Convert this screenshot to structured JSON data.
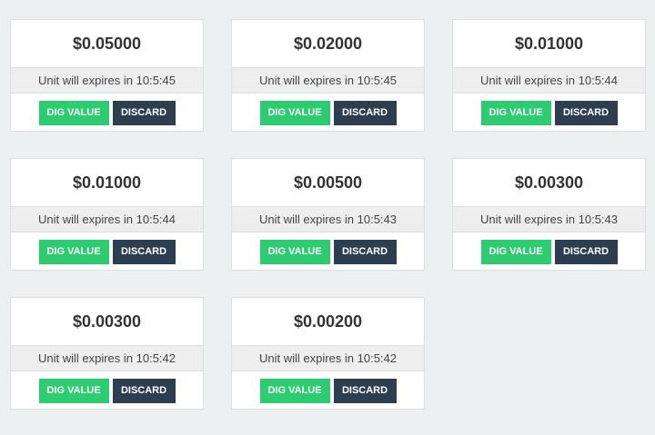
{
  "colors": {
    "page_background": "#ecf0f1",
    "dig_button": "#2ecc71",
    "discard_button": "#2c3e50",
    "expiry_strip": "#eeeeee"
  },
  "cards": [
    {
      "price": "$0.05000",
      "expiry": "Unit will expires in 10:5:45",
      "dig_label": "DIG VALUE",
      "discard_label": "DISCARD"
    },
    {
      "price": "$0.02000",
      "expiry": "Unit will expires in 10:5:45",
      "dig_label": "DIG VALUE",
      "discard_label": "DISCARD"
    },
    {
      "price": "$0.01000",
      "expiry": "Unit will expires in 10:5:44",
      "dig_label": "DIG VALUE",
      "discard_label": "DISCARD"
    },
    {
      "price": "$0.01000",
      "expiry": "Unit will expires in 10:5:44",
      "dig_label": "DIG VALUE",
      "discard_label": "DISCARD"
    },
    {
      "price": "$0.00500",
      "expiry": "Unit will expires in 10:5:43",
      "dig_label": "DIG VALUE",
      "discard_label": "DISCARD"
    },
    {
      "price": "$0.00300",
      "expiry": "Unit will expires in 10:5:43",
      "dig_label": "DIG VALUE",
      "discard_label": "DISCARD"
    },
    {
      "price": "$0.00300",
      "expiry": "Unit will expires in 10:5:42",
      "dig_label": "DIG VALUE",
      "discard_label": "DISCARD"
    },
    {
      "price": "$0.00200",
      "expiry": "Unit will expires in 10:5:42",
      "dig_label": "DIG VALUE",
      "discard_label": "DISCARD"
    }
  ]
}
